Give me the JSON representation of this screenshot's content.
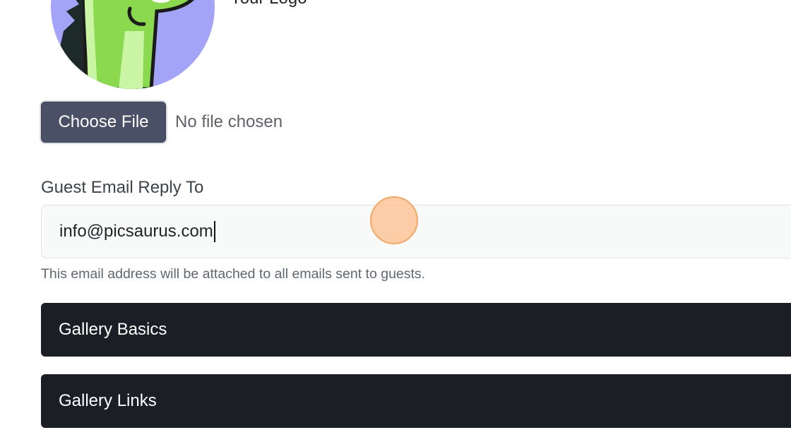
{
  "logo": {
    "caption": "Your Logo",
    "icon": "dinosaur-logo-icon"
  },
  "file_input": {
    "button_label": "Choose File",
    "status": "No file chosen"
  },
  "guest_email": {
    "label": "Guest Email Reply To",
    "value": "info@picsaurus.com",
    "help": "This email address will be attached to all emails sent to guests."
  },
  "sections": [
    {
      "label": "Gallery Basics"
    },
    {
      "label": "Gallery Links"
    }
  ],
  "colors": {
    "button_bg": "#4a5066",
    "accordion_bg": "#1b1e25",
    "click_marker": "#f9c49a"
  }
}
